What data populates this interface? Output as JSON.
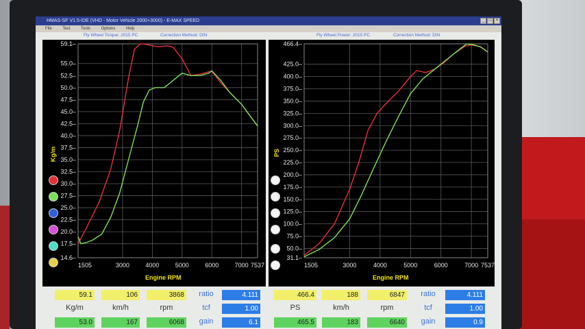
{
  "window": {
    "title": "HMAS-SF V1.5-IDE  (VHD - Motor Vehicle 2000+3000) - E-MAX SPEED",
    "menu": [
      "File",
      "Test",
      "Tools",
      "Options",
      "Help"
    ]
  },
  "left_header": {
    "title": "Fly Wheel Torque: 2015  PC",
    "correction": "Correction Method: DIN"
  },
  "right_header": {
    "title": "Fly Wheel Power: 2015  PC",
    "correction": "Correction Method: DIN"
  },
  "colors": {
    "run1": "#e8303a",
    "run2": "#7ee05a",
    "overlap": "#e9e25a",
    "axis_title": "#f5e600",
    "dots": [
      "#e8303a",
      "#7ee05a",
      "#2f5fd8",
      "#d84fd8",
      "#4ee0c8",
      "#e6d04a"
    ]
  },
  "chart_data": [
    {
      "type": "line",
      "title": "Fly Wheel Torque: 2015  PC",
      "xlabel": "Engine RPM",
      "ylabel": "Kg/m",
      "xlim": [
        1505,
        7537
      ],
      "ylim": [
        14.6,
        59.1
      ],
      "x_ticks": [
        "1505",
        "3000",
        "4000",
        "5000",
        "6000",
        "7000",
        "7537"
      ],
      "y_ticks": [
        "59.1",
        "55.0",
        "52.5",
        "50.0",
        "47.5",
        "45.0",
        "42.5",
        "40.0",
        "37.5",
        "35.0",
        "32.5",
        "30.0",
        "27.5",
        "25.0",
        "22.5",
        "20.0",
        "17.5",
        "14.6"
      ],
      "series": [
        {
          "x": [
            1505,
            1800,
            2200,
            2600,
            2900,
            3200,
            3400,
            3600,
            3800,
            4000,
            4200,
            4500,
            4700,
            5000,
            5300,
            5600,
            5900,
            6000,
            6300,
            6600,
            7000,
            7300,
            7537
          ],
          "y": [
            17.5,
            21,
            26,
            33,
            41,
            52,
            58,
            59.1,
            59,
            58.7,
            58.5,
            58.7,
            58.4,
            56,
            52.5,
            52.8,
            53.3,
            53.4,
            51,
            49,
            46.5,
            44,
            42
          ]
        },
        {
          "x": [
            1505,
            1600,
            1800,
            2000,
            2300,
            2600,
            2900,
            3200,
            3500,
            3700,
            3900,
            4100,
            4400,
            4700,
            5000,
            5300,
            5600,
            5900,
            6000,
            6300,
            6600,
            7000,
            7300,
            7537
          ],
          "y": [
            19,
            17.5,
            17.8,
            18.3,
            19.5,
            23,
            28,
            35,
            42,
            47,
            49.5,
            50,
            50,
            51.5,
            53,
            52.5,
            52.5,
            53,
            53.5,
            51.5,
            49,
            46.5,
            44,
            42
          ]
        }
      ]
    },
    {
      "type": "line",
      "title": "Fly Wheel Power: 2015  PC",
      "xlabel": "Engine RPM",
      "ylabel": "PS",
      "xlim": [
        1505,
        7537
      ],
      "ylim": [
        31.1,
        466.4
      ],
      "x_ticks": [
        "1505",
        "3000",
        "4000",
        "5000",
        "6000",
        "7000",
        "7537"
      ],
      "y_ticks": [
        "466.4",
        "425.0",
        "400.0",
        "375.0",
        "350.0",
        "325.0",
        "300.0",
        "275.0",
        "250.0",
        "225.0",
        "200.0",
        "175.0",
        "150.0",
        "125.0",
        "100.0",
        "75.0",
        "50.0",
        "31.1"
      ],
      "series": [
        {
          "x": [
            1505,
            2000,
            2500,
            3000,
            3300,
            3600,
            3900,
            4200,
            4600,
            5000,
            5200,
            5500,
            5800,
            6100,
            6400,
            6800,
            7000,
            7300,
            7537
          ],
          "y": [
            36,
            60,
            100,
            170,
            225,
            290,
            325,
            345,
            370,
            400,
            412,
            408,
            415,
            428,
            445,
            462,
            464,
            461,
            450
          ]
        },
        {
          "x": [
            1505,
            2000,
            2500,
            3000,
            3400,
            3800,
            4200,
            4600,
            5000,
            5400,
            5800,
            6200,
            6600,
            6847,
            7100,
            7300,
            7537
          ],
          "y": [
            33,
            48,
            72,
            110,
            160,
            215,
            268,
            318,
            365,
            395,
            415,
            435,
            455,
            466.4,
            464,
            460,
            450
          ]
        }
      ]
    }
  ],
  "left_readout": {
    "torque": "59.1",
    "speed": "106",
    "rpm": "3868",
    "ratio_label": "ratio",
    "ratio": "4.111",
    "unit1": "Kg/m",
    "unit2": "km/h",
    "unit3": "rpm",
    "tcf_label": "tcf",
    "tcf": "1.00",
    "torque2": "53.0",
    "speed2": "167",
    "rpm2": "6068",
    "gain_label": "gain",
    "gain": "6.1"
  },
  "right_readout": {
    "power": "466.4",
    "speed": "188",
    "rpm": "6847",
    "ratio_label": "ratio",
    "ratio": "4.111",
    "unit1": "PS",
    "unit2": "km/h",
    "unit3": "rpm",
    "tcf_label": "tcf",
    "tcf": "1.00",
    "power2": "465.5",
    "speed2": "183",
    "rpm2": "6640",
    "gain_label": "gain",
    "gain": "0.9"
  }
}
